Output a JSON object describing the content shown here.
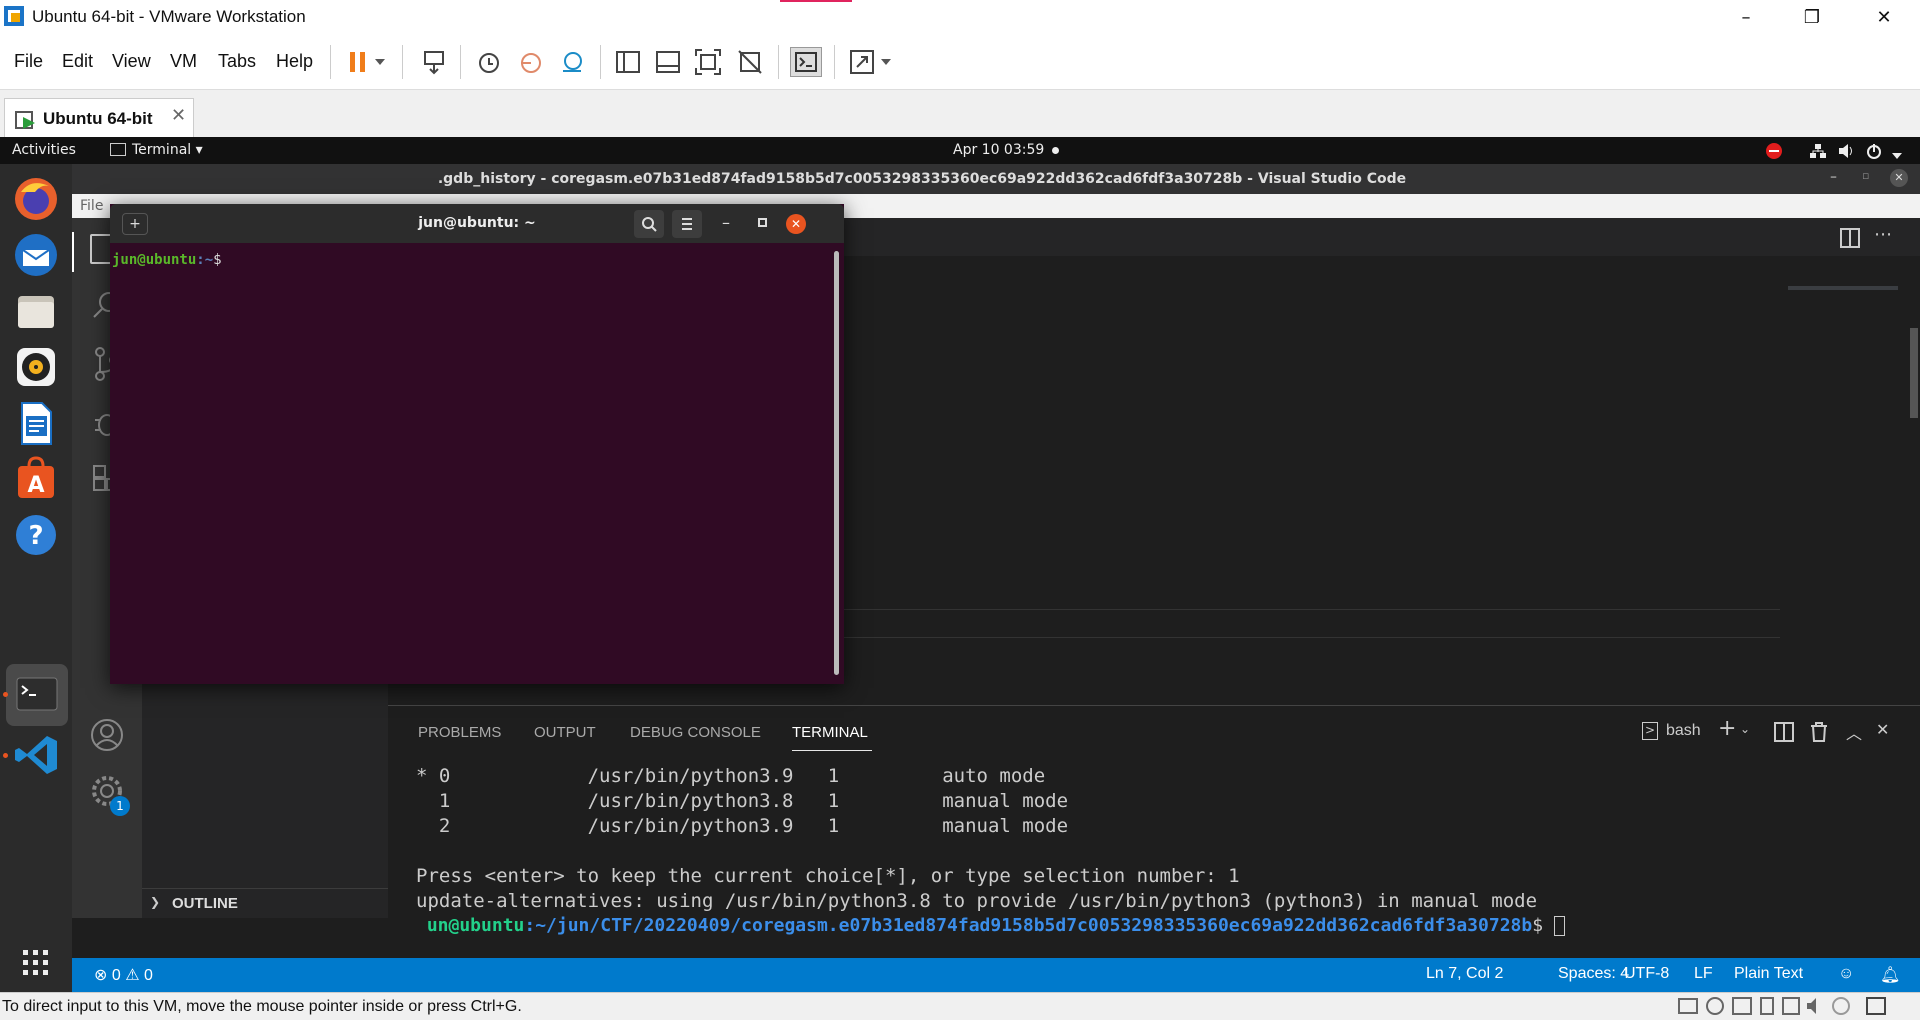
{
  "window": {
    "title": "Ubuntu 64-bit - VMware Workstation",
    "minimize": "–",
    "restore": "❐",
    "close": "✕"
  },
  "menu": {
    "items": [
      "File",
      "Edit",
      "View",
      "VM",
      "Tabs",
      "Help"
    ]
  },
  "tab": {
    "label": "Ubuntu 64-bit",
    "close": "✕"
  },
  "gnome": {
    "activities": "Activities",
    "app": "Terminal ▾",
    "clock": "Apr 10  03:59"
  },
  "vscode": {
    "title": ".gdb_history - coregasm.e07b31ed874fad9158b5d7c0053298335360ec69a922dd362cad6fdf3a30728b - Visual Studio Code",
    "menu_file": "File",
    "outline": "OUTLINE",
    "settings_badge": "1",
    "panel_tabs": [
      "PROBLEMS",
      "OUTPUT",
      "DEBUG CONSOLE",
      "TERMINAL"
    ],
    "shell": "bash",
    "terminal_lines": [
      "* 0            /usr/bin/python3.9   1         auto mode",
      "  1            /usr/bin/python3.8   1         manual mode",
      "  2            /usr/bin/python3.9   1         manual mode",
      "",
      "Press <enter> to keep the current choice[*], or type selection number: 1",
      "update-alternatives: using /usr/bin/python3.8 to provide /usr/bin/python3 (python3) in manual mode"
    ],
    "prompt_user": " un@ubuntu",
    "prompt_path": ":~/jun/CTF/20220409/coregasm.e07b31ed874fad9158b5d7c0053298335360ec69a922dd362cad6fdf3a30728b",
    "prompt_sym": "$ ",
    "status": {
      "errors": "0",
      "warnings": "0",
      "position": "Ln 7, Col 2",
      "spaces": "Spaces: 4",
      "encoding": "UTF-8",
      "eol": "LF",
      "language": "Plain Text"
    }
  },
  "gterm": {
    "title": "jun@ubuntu: ~",
    "prompt_user": "jun@ubuntu",
    "prompt_path": ":~",
    "prompt_sym": "$"
  },
  "hostbar": {
    "text": "To direct input to this VM, move the mouse pointer inside or press Ctrl+G."
  }
}
